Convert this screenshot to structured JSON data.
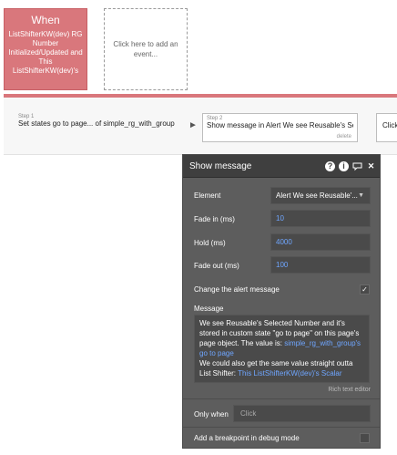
{
  "when": {
    "title": "When",
    "description": "ListShifterKW(dev) RG Number Initialized/Updated and This ListShifterKW(dev)'s"
  },
  "add_event": "Click here to add an event...",
  "steps": [
    {
      "label": "Step 1",
      "text": "Set states go to page... of simple_rg_with_group"
    },
    {
      "label": "Step 2",
      "text": "Show message in Alert We see Reusable's Se",
      "delete": "delete"
    },
    {
      "label": "",
      "text": "Click"
    }
  ],
  "panel": {
    "title": "Show message",
    "icons": [
      "question-icon",
      "info-icon",
      "comment-icon",
      "close-icon"
    ],
    "element": {
      "label": "Element",
      "value": "Alert We see Reusable'..."
    },
    "fade_in": {
      "label": "Fade in (ms)",
      "value": "10"
    },
    "hold": {
      "label": "Hold (ms)",
      "value": "4000"
    },
    "fade_out": {
      "label": "Fade out (ms)",
      "value": "100"
    },
    "change_alert": {
      "label": "Change the alert message",
      "checked": true
    },
    "message": {
      "label": "Message",
      "part1": "We see Reusable's Selected Number and it's stored in custom state \"go to page\" on this page's page object. The value is: ",
      "dyn1": "simple_rg_with_group's go to page",
      "part2": "We could also get the same value straight outta List Shifter: ",
      "dyn2": "This ListShifterKW(dev)'s Scalar"
    },
    "rich_text": "Rich text editor",
    "only_when": {
      "label": "Only when",
      "placeholder": "Click"
    },
    "breakpoint": {
      "label": "Add a breakpoint in debug mode",
      "checked": false
    }
  },
  "colors": {
    "event_block": "#d9777c",
    "panel_bg": "#5d5d5d",
    "dynamic_text": "#6fa6ff"
  }
}
